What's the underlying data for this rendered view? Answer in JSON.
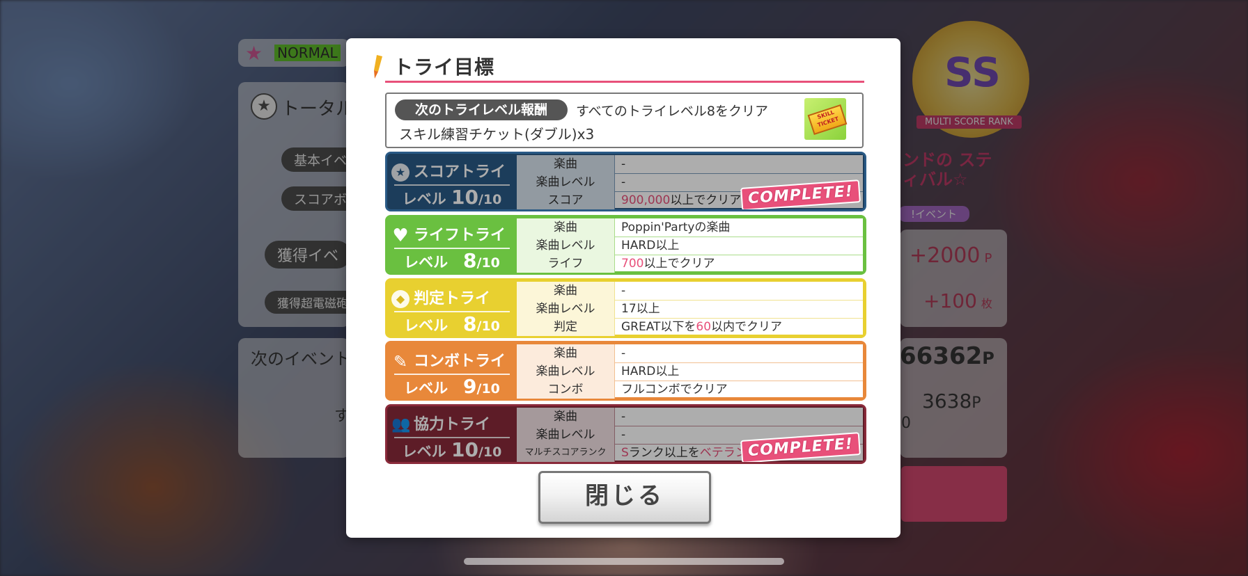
{
  "background": {
    "mode_badge": "NORMAL",
    "total_label": "トータル",
    "basic_label": "基本イベ",
    "score_label": "スコアボ",
    "earned_event": "獲得イベ",
    "earned_super": "獲得超電磁砲",
    "next_event": "次のイベント",
    "side_char": "す",
    "rank_label": "MULTI SCORE RANK",
    "rank_value": "SS",
    "event_tag": "!イベント",
    "logo_text": "ンドの スティバル☆",
    "plus_points": "+2000",
    "points_unit": "P",
    "plus_count": "+100",
    "count_unit": "枚",
    "total_points": "66362",
    "next_points": "3638",
    "small_num": "0"
  },
  "modal": {
    "title": "トライ目標",
    "reward": {
      "pill": "次のトライレベル報酬",
      "condition": "すべてのトライレベル8をクリア",
      "item": "スキル練習チケット(ダブル)x3",
      "ticket_text": "SKILL TICKET"
    },
    "tries": [
      {
        "name": "スコアトライ",
        "icon": "star-icon",
        "level_prefix": "レベル",
        "level": "10",
        "level_max": "/10",
        "rows": [
          {
            "key": "楽曲",
            "pre": "-",
            "hl": "",
            "post": ""
          },
          {
            "key": "楽曲レベル",
            "pre": "-",
            "hl": "",
            "post": ""
          },
          {
            "key": "スコア",
            "pre": "",
            "hl": "900,000",
            "post": "以上でクリア"
          }
        ],
        "complete": "COMPLETE!"
      },
      {
        "name": "ライフトライ",
        "icon": "heart-icon",
        "level_prefix": "レベル",
        "level": "8",
        "level_max": "/10",
        "rows": [
          {
            "key": "楽曲",
            "pre": "Poppin'Partyの楽曲",
            "hl": "",
            "post": ""
          },
          {
            "key": "楽曲レベル",
            "pre": "HARD以上",
            "hl": "",
            "post": ""
          },
          {
            "key": "ライフ",
            "pre": "",
            "hl": "700",
            "post": "以上でクリア"
          }
        ]
      },
      {
        "name": "判定トライ",
        "icon": "diamond-icon",
        "level_prefix": "レベル",
        "level": "8",
        "level_max": "/10",
        "rows": [
          {
            "key": "楽曲",
            "pre": "-",
            "hl": "",
            "post": ""
          },
          {
            "key": "楽曲レベル",
            "pre": "17以上",
            "hl": "",
            "post": ""
          },
          {
            "key": "判定",
            "pre": "GREAT以下を",
            "hl": "60",
            "post": "以内でクリア"
          }
        ]
      },
      {
        "name": "コンボトライ",
        "icon": "pen-icon",
        "level_prefix": "レベル",
        "level": "9",
        "level_max": "/10",
        "rows": [
          {
            "key": "楽曲",
            "pre": "-",
            "hl": "",
            "post": ""
          },
          {
            "key": "楽曲レベル",
            "pre": "HARD以上",
            "hl": "",
            "post": ""
          },
          {
            "key": "コンボ",
            "pre": "フルコンボでクリア",
            "hl": "",
            "post": ""
          }
        ]
      },
      {
        "name": "協力トライ",
        "icon": "people-icon",
        "level_prefix": "レベル",
        "level": "10",
        "level_max": "/10",
        "rows": [
          {
            "key": "楽曲",
            "pre": "-",
            "hl": "",
            "post": ""
          },
          {
            "key": "楽曲レベル",
            "pre": "-",
            "hl": "",
            "post": ""
          },
          {
            "key": "マルチスコアランク",
            "pre": "S",
            "hl": "",
            "post": "ランク以上を",
            "hl2": "ベテランルー"
          }
        ],
        "complete": "COMPLETE!"
      }
    ],
    "close_label": "閉じる"
  },
  "colors": {
    "accent": "#e8507a",
    "score": "#2a5a86",
    "life": "#6ac040",
    "judge": "#e8d030",
    "combo": "#e8883a",
    "coop": "#8a2a3a"
  }
}
